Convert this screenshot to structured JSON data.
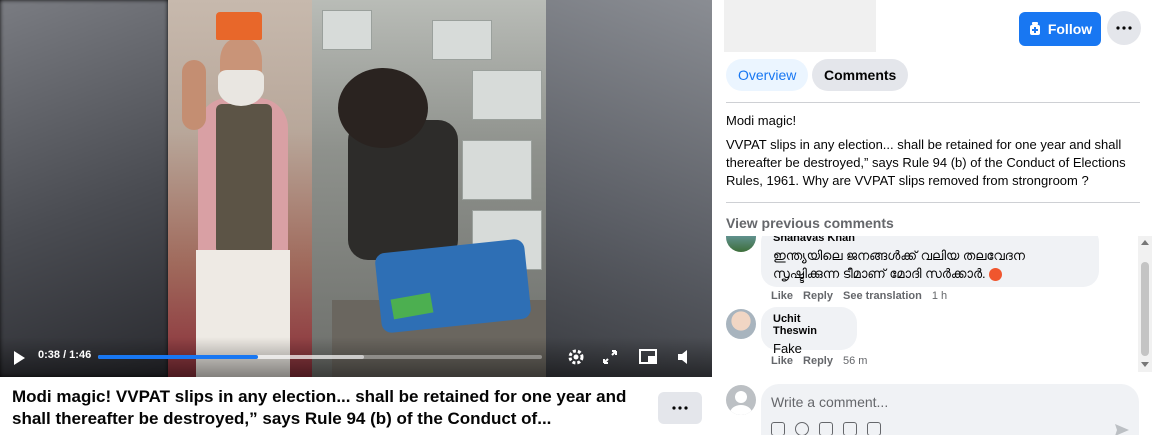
{
  "video": {
    "time": "0:38 / 1:46",
    "progress": 0.36,
    "buffered": 0.6
  },
  "post": {
    "title": "Modi magic! VVPAT slips in any election... shall be retained for one year and shall thereafter be destroyed,” says Rule 94 (b) of the Conduct of..."
  },
  "panel": {
    "follow_label": "Follow",
    "tabs": [
      "Overview",
      "Comments"
    ],
    "caption_title": "Modi magic!",
    "caption_body": "VVPAT slips in any election... shall be retained for one year and shall thereafter be destroyed,” says Rule 94 (b) of the Conduct of Elections Rules, 1961. Why are VVPAT slips removed from strongroom ?",
    "view_previous": "View previous comments"
  },
  "comments": [
    {
      "name": "Shahavas Khan",
      "text": "ഇന്ത്യയിലെ ജനങ്ങൾക്ക് വലിയ തലവേദന സൃഷ്ടിക്കുന്ന ടീമാണ് മോദി സർക്കാർ.",
      "like": "Like",
      "reply": "Reply",
      "translate": "See translation",
      "time": "1 h"
    },
    {
      "name": "Uchit Theswin",
      "text": "Fake",
      "like": "Like",
      "reply": "Reply",
      "time": "56 m"
    }
  ],
  "composer": {
    "placeholder": "Write a comment..."
  },
  "colors": {
    "accent": "#1877f2",
    "bubble": "#f0f2f5",
    "angry_emoji": "#f0562e"
  }
}
